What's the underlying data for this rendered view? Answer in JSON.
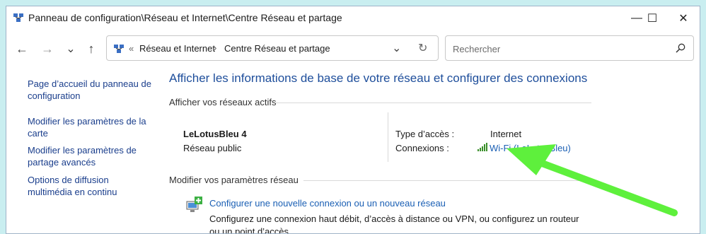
{
  "window": {
    "title": "Panneau de configuration\\Réseau et Internet\\Centre Réseau et partage",
    "minimize_glyph": "—",
    "maximize_glyph": "☐",
    "close_glyph": "✕"
  },
  "addressbar": {
    "back_glyph": "←",
    "forward_glyph": "→",
    "recent_glyph": "⌄",
    "up_glyph": "↑",
    "overflow": "«",
    "crumbs": [
      "Réseau et Internet",
      "Centre Réseau et partage"
    ],
    "crumb_separator": "›",
    "dropdown_glyph": "⌄",
    "refresh_glyph": "↻"
  },
  "search": {
    "placeholder": "Rechercher"
  },
  "sidebar": {
    "links": [
      "Page d’accueil du panneau de configuration",
      "Modifier les paramètres de la carte",
      "Modifier les paramètres de partage avancés",
      "Options de diffusion multimédia en continu"
    ]
  },
  "main": {
    "title": "Afficher les informations de base de votre réseau et configurer des connexions",
    "active_networks_label": "Afficher vos réseaux actifs",
    "network": {
      "name": "LeLotusBleu 4",
      "type": "Réseau public",
      "access_type_label": "Type d’accès :",
      "access_type_value": "Internet",
      "connections_label": "Connexions :",
      "connection_value": "Wi-Fi (LeLotusBleu)"
    },
    "modify_label": "Modifier vos paramètres réseau",
    "configure": {
      "link": "Configurer une nouvelle connexion ou un nouveau réseau",
      "description": "Configurez une connexion haut débit, d’accès à distance ou VPN, ou configurez un routeur ou un point d’accès."
    }
  },
  "colors": {
    "link": "#1a5fb4",
    "title": "#1e4e9b",
    "annotation_arrow": "#5ef03c",
    "background": "#c9eef0"
  },
  "icons": {
    "title": "network-center-icon",
    "crumb": "network-center-icon",
    "wifi": "wifi-signal-icon",
    "configure": "new-connection-icon",
    "search": "search-icon"
  }
}
